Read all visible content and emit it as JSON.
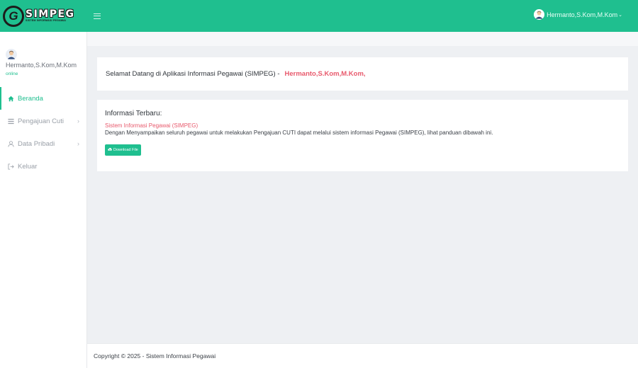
{
  "brand": {
    "logo_letter": "G",
    "title": "SIMPEG",
    "subtitle": "SISTEM INFORMASI PEGAWAI",
    "accent_color": "#1fbf8f",
    "highlight_color": "#e8596c"
  },
  "header": {
    "menu_icon": "hamburger-icon",
    "user_name": "Hermanto,S.Kom,M.Kom",
    "dropdown_icon": "caret-down-icon"
  },
  "sidebar": {
    "user_name": "Hermanto,S.Kom,M.Kom",
    "status": "online",
    "items": [
      {
        "label": "Beranda",
        "icon": "home-icon",
        "active": true
      },
      {
        "label": "Pengajuan Cuti",
        "icon": "list-icon",
        "has_submenu": true
      },
      {
        "label": "Data Pribadi",
        "icon": "user-icon",
        "has_submenu": true
      },
      {
        "label": "Keluar",
        "icon": "logout-icon"
      }
    ]
  },
  "main": {
    "welcome_text": "Selamat Datang di Aplikasi Informasi Pegawai (SIMPEG) -",
    "welcome_name": "Hermanto,S.Kom,M.Kom,",
    "info_title": "Informasi Terbaru:",
    "info_subtitle": "Sistem Informasi Pegawai (SIMPEG)",
    "info_text": "Dengan Menyampaikan seluruh pegawai untuk melakukan Pengajuan CUTI dapat melalui sistem informasi Pegawai (SIMPEG), lihat panduan dibawah ini.",
    "download_label": "Download File",
    "download_icon": "cloud-download-icon"
  },
  "footer": {
    "copyright": "Copyright © 2025 - Sistem Informasi Pegawai"
  }
}
